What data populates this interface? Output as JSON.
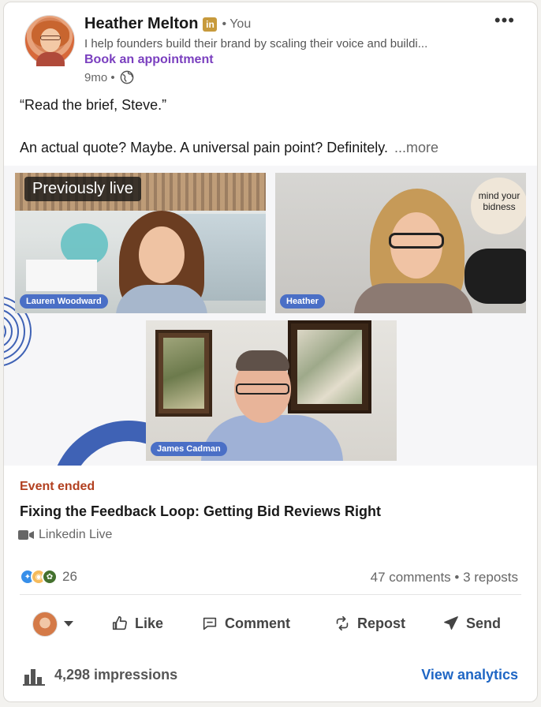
{
  "author": {
    "name": "Heather Melton",
    "badge": "in",
    "degree": "• You",
    "headline": "I help founders build their brand by scaling their voice and buildi...",
    "appointment_link": "Book an appointment",
    "time": "9mo •"
  },
  "post": {
    "line1": "“Read the brief, Steve.”",
    "line2": "An actual quote? Maybe. A universal pain point? Definitely.",
    "see_more": "...more"
  },
  "media": {
    "live_badge": "Previously live",
    "participants": [
      "Lauren Woodward",
      "Heather",
      "James Cadman"
    ],
    "logo_text": "mind your bidness"
  },
  "event": {
    "status": "Event ended",
    "title": "Fixing the Feedback Loop: Getting Bid Reviews Right",
    "type": "Linkedin Live"
  },
  "social": {
    "reaction_count": "26",
    "comments_reposts": "47 comments • 3 reposts"
  },
  "actions": {
    "like": "Like",
    "comment": "Comment",
    "repost": "Repost",
    "send": "Send"
  },
  "footer": {
    "impressions": "4,298 impressions",
    "analytics": "View analytics"
  },
  "colors": {
    "accent_purple": "#7a3fbf",
    "event_status": "#b24020",
    "link_blue": "#1f66c4",
    "name_tag_blue": "#4a6fc6"
  },
  "icons": [
    "linkedin-badge-icon",
    "globe-icon",
    "more-options-icon",
    "video-camera-icon",
    "like-icon",
    "comment-icon",
    "repost-icon",
    "send-icon",
    "analytics-bar-icon",
    "dropdown-caret-icon"
  ]
}
